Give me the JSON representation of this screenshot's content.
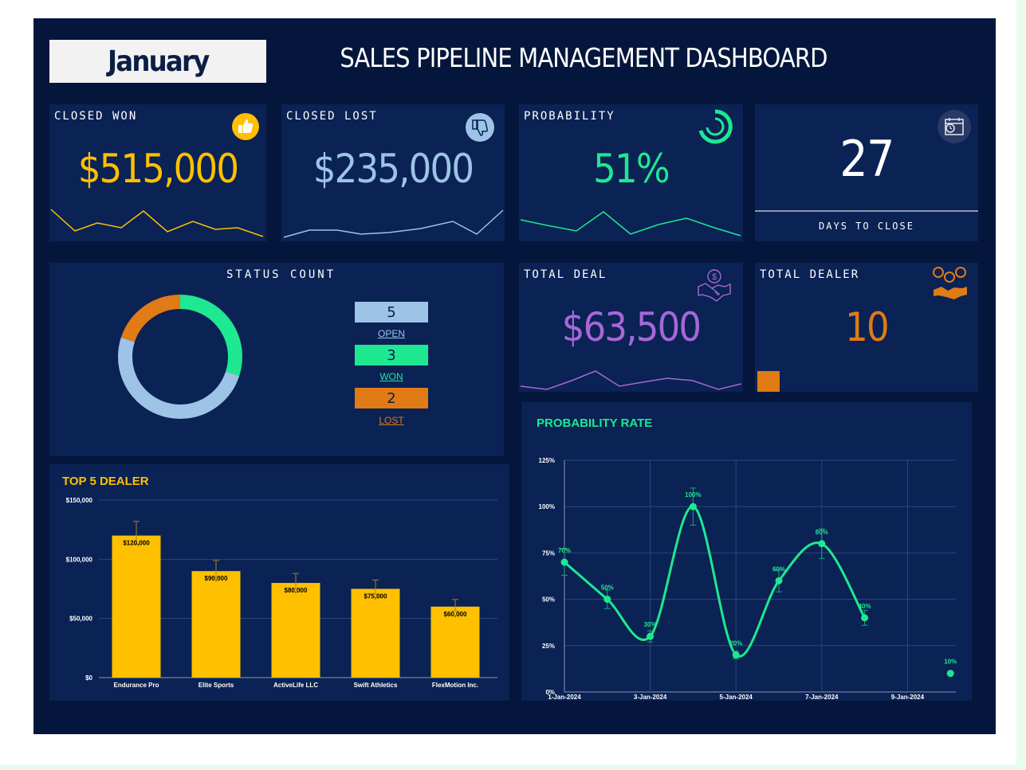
{
  "header": {
    "month": "January",
    "title": "SALES PIPELINE MANAGEMENT DASHBOARD"
  },
  "kpis": {
    "closed_won": {
      "label": "CLOSED WON",
      "value": "$515,000",
      "color": "#ffc000",
      "icon": "thumbs-up-icon"
    },
    "closed_lost": {
      "label": "CLOSED LOST",
      "value": "$235,000",
      "color": "#9dc3e6",
      "icon": "thumbs-down-icon"
    },
    "probability": {
      "label": "PROBABILITY",
      "value": "51%",
      "color": "#1ee890",
      "icon": "progress-ring-icon"
    },
    "days_to_close": {
      "label": "DAYS TO CLOSE",
      "value": "27",
      "color": "#ffffff",
      "icon": "calendar-clock-icon"
    },
    "total_deal": {
      "label": "TOTAL DEAL",
      "value": "$63,500",
      "color": "#a767d6",
      "icon": "handshake-dollar-icon"
    },
    "total_dealer": {
      "label": "TOTAL DEALER",
      "value": "10",
      "color": "#e07b16",
      "icon": "dealer-group-icon"
    }
  },
  "status_count": {
    "title": "STATUS COUNT",
    "items": [
      {
        "count": "5",
        "label": "OPEN",
        "color": "#9dc3e6"
      },
      {
        "count": "3",
        "label": "WON",
        "color": "#1ee890"
      },
      {
        "count": "2",
        "label": "LOST",
        "color": "#e07b16"
      }
    ]
  },
  "chart_data": [
    {
      "type": "bar",
      "title": "TOP 5 DEALER",
      "categories": [
        "Endurance Pro",
        "Elite Sports",
        "ActiveLife LLC",
        "Swift Athletics",
        "FlexMotion Inc."
      ],
      "values": [
        120000,
        90000,
        80000,
        75000,
        60000
      ],
      "data_labels": [
        "$120,000",
        "$90,000",
        "$80,000",
        "$75,000",
        "$60,000"
      ],
      "ylim": [
        0,
        150000
      ],
      "yticks": [
        "$0",
        "$50,000",
        "$100,000",
        "$150,000"
      ],
      "color": "#ffc000",
      "grid": true
    },
    {
      "type": "line",
      "title": "PROBABILITY RATE",
      "x": [
        "1-Jan-2024",
        "2-Jan-2024",
        "3-Jan-2024",
        "4-Jan-2024",
        "5-Jan-2024",
        "6-Jan-2024",
        "7-Jan-2024",
        "8-Jan-2024",
        "10-Jan-2024"
      ],
      "values": [
        70,
        50,
        30,
        100,
        20,
        60,
        80,
        40,
        10
      ],
      "data_labels": [
        "70%",
        "50%",
        "30%",
        "100%",
        "20%",
        "60%",
        "80%",
        "40%",
        "10%"
      ],
      "xticks": [
        "1-Jan-2024",
        "3-Jan-2024",
        "5-Jan-2024",
        "7-Jan-2024",
        "9-Jan-2024"
      ],
      "yticks": [
        "0%",
        "25%",
        "50%",
        "75%",
        "100%",
        "125%"
      ],
      "ylim": [
        0,
        125
      ],
      "color": "#1ee890",
      "grid": true
    }
  ]
}
